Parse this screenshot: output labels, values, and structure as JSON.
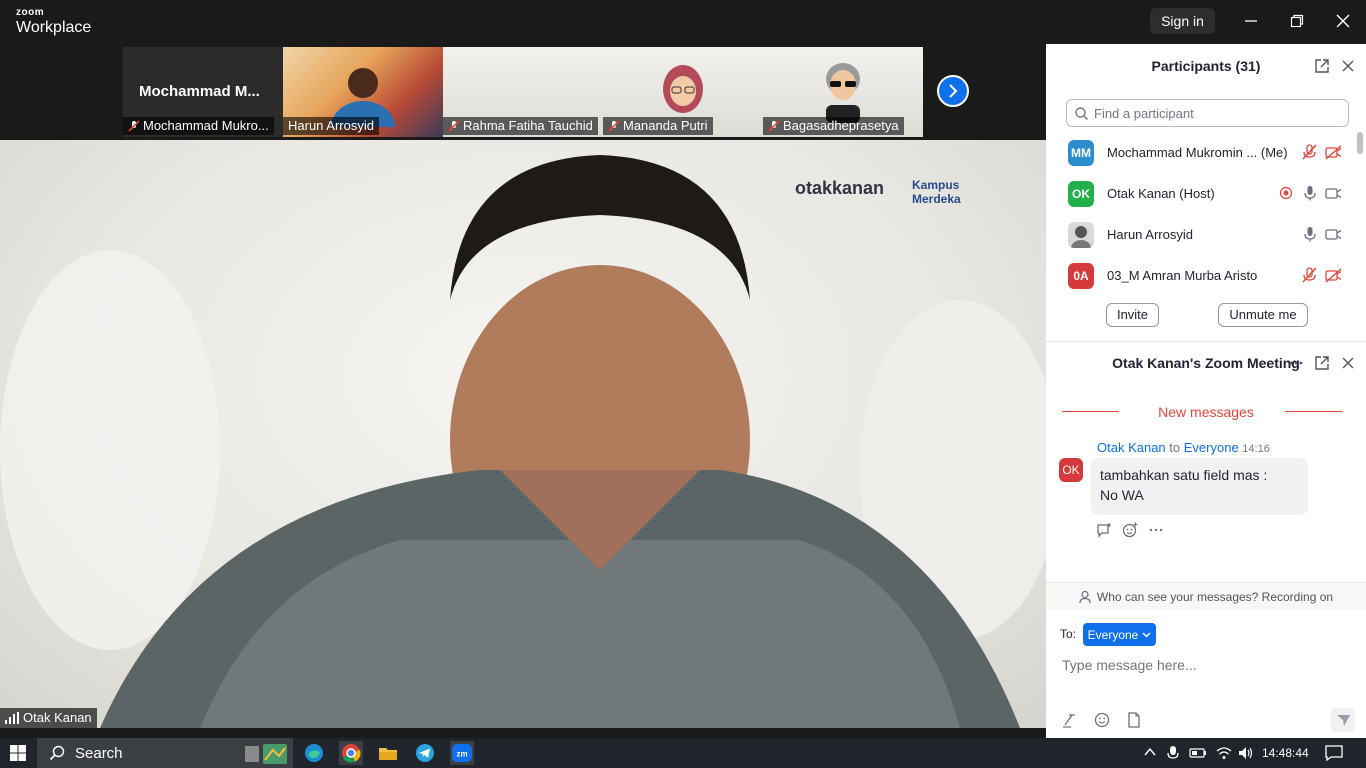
{
  "titlebar": {
    "logo_top": "zoom",
    "logo_bottom": "Workplace",
    "sign_in": "Sign in"
  },
  "thumbnails": [
    {
      "name": "Mochammad Mukro...",
      "big_name": "Mochammad  M...",
      "muted": true
    },
    {
      "name": "Harun Arrosyid",
      "muted": false
    },
    {
      "name": "Rahma Fatiha Tauchid",
      "muted": true
    },
    {
      "name": "Mananda Putri",
      "muted": true
    },
    {
      "name": "Bagasadheprasetya",
      "muted": true
    }
  ],
  "main_video": {
    "speaker": "Otak Kanan",
    "brand_left": "otakkanan",
    "brand_right": "Kampus Merdeka"
  },
  "participants": {
    "title": "Participants (31)",
    "search_placeholder": "Find a participant",
    "list": [
      {
        "initials": "MM",
        "name": "Mochammad Mukromin ...",
        "tag": "(Me)",
        "color": "#2d8cce",
        "mic": "muted",
        "video": "off"
      },
      {
        "initials": "OK",
        "name": "Otak Kanan (Host)",
        "tag": "",
        "color": "#23b04a",
        "mic": "on",
        "video": "on",
        "recording": true
      },
      {
        "initials": "",
        "name": "Harun Arrosyid",
        "tag": "",
        "color": "#cccccc",
        "mic": "on",
        "video": "on"
      },
      {
        "initials": "0A",
        "name": "03_M Amran Murba Aristo",
        "tag": "",
        "color": "#d5393b",
        "mic": "muted",
        "video": "off"
      }
    ],
    "invite": "Invite",
    "unmute": "Unmute me"
  },
  "chat": {
    "title": "Otak Kanan's Zoom Meeting",
    "new_messages": "New messages",
    "message": {
      "sender": "Otak Kanan",
      "to_word": "to",
      "recipient": "Everyone",
      "time": "14:16",
      "avatar": "OK",
      "text_line1": "tambahkan satu field mas :",
      "text_line2": "No WA"
    },
    "who_can_see": "Who can see your messages? Recording on",
    "to_label": "To:",
    "to_value": "Everyone",
    "input_placeholder": "Type message here..."
  },
  "taskbar": {
    "search": "Search",
    "time": "14:48:44"
  },
  "colors": {
    "accent": "#0e71eb",
    "alert": "#e0453a"
  }
}
